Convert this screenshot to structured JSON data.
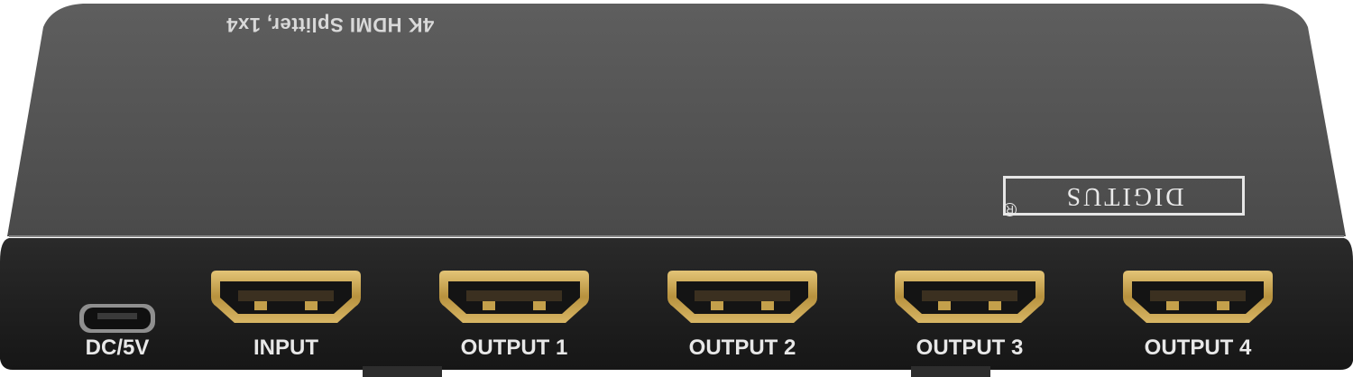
{
  "device": {
    "model_text": "4K HDMI Splitter, 1x4",
    "brand": "DIGITUS",
    "brand_mark": "R"
  },
  "ports": {
    "power": "DC/5V",
    "input": "INPUT",
    "output1": "OUTPUT 1",
    "output2": "OUTPUT 2",
    "output3": "OUTPUT 3",
    "output4": "OUTPUT 4"
  },
  "colors": {
    "top_panel": "#595959",
    "front_panel": "#1c1c1c",
    "hdmi_gold": "#c9a24a",
    "label_text": "#e8e8e8"
  }
}
